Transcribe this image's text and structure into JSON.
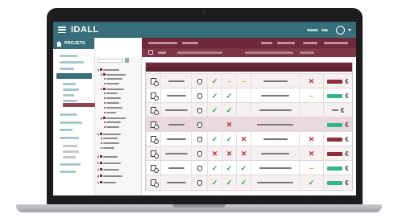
{
  "app": {
    "title": "IDALL"
  },
  "sidebar": {
    "active_tab": "PROJETS"
  },
  "icons": {
    "menu": "hamburger-icon",
    "user": "user-circle-icon",
    "home": "home-icon",
    "doc": "document-search-icon",
    "hand": "hand-icon"
  },
  "colors": {
    "primary": "#376e7a",
    "accent": "#6e2a3a",
    "check": "#2aa167",
    "cross": "#b62b3a",
    "dash": "#d3a52c",
    "pill_green": "#35b58d",
    "pill_red": "#8f2d3c"
  },
  "table": {
    "rows": [
      {
        "style": "alt",
        "c1": "check",
        "c2": "dash",
        "c3": "dash",
        "c4": "cross",
        "pill": "red",
        "currency": "€"
      },
      {
        "style": "",
        "c1": "check",
        "c2": "check",
        "c3": "",
        "c4": "dash",
        "pill": "green",
        "currency": "€"
      },
      {
        "style": "alt",
        "c1": "check",
        "c2": "check",
        "c3": "",
        "c4": "",
        "pill": "short",
        "currency": "€"
      },
      {
        "style": "hl",
        "c1": "",
        "c2": "cross",
        "c3": "",
        "c4": "",
        "pill": "green",
        "currency": "€"
      },
      {
        "style": "",
        "c1": "check",
        "c2": "check",
        "c3": "cross",
        "c4": "cross",
        "pill": "red",
        "currency": "€"
      },
      {
        "style": "alt",
        "c1": "cross",
        "c2": "cross",
        "c3": "cross",
        "c4": "cross",
        "pill": "red",
        "currency": "€"
      },
      {
        "style": "",
        "c1": "check",
        "c2": "check",
        "c3": "check",
        "c4": "dash",
        "pill": "green",
        "currency": "€"
      },
      {
        "style": "alt",
        "c1": "check",
        "c2": "check",
        "c3": "check",
        "c4": "check",
        "pill": "green",
        "currency": "€"
      }
    ]
  }
}
